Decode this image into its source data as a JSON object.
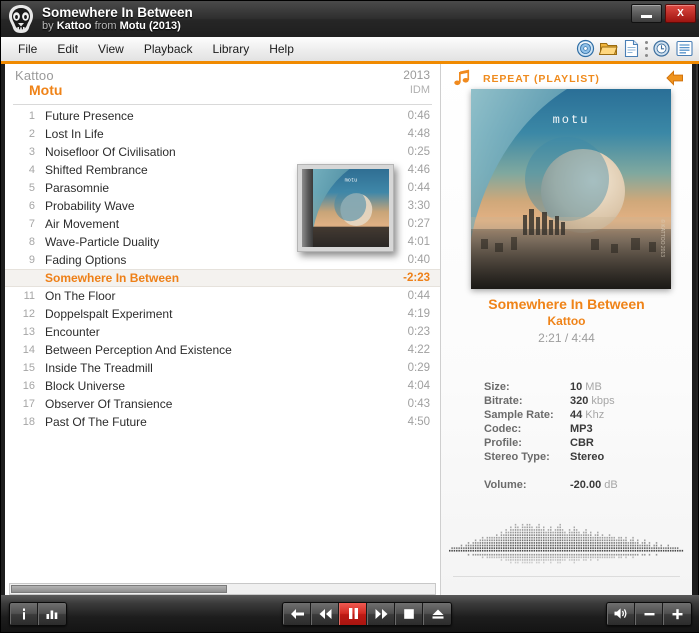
{
  "window": {
    "title": "Somewhere In Between",
    "subtitle_by": "by",
    "subtitle_artist": "Kattoo",
    "subtitle_from": "from",
    "subtitle_album": "Motu (2013)",
    "logo_icon": "foobar-skull-icon",
    "minimize_label": "minimize-button",
    "close_label": "X"
  },
  "menu": {
    "items": [
      {
        "label": "File"
      },
      {
        "label": "Edit"
      },
      {
        "label": "View"
      },
      {
        "label": "Playback"
      },
      {
        "label": "Library"
      },
      {
        "label": "Help"
      }
    ],
    "toolbar": [
      {
        "icon": "cd-disc-icon"
      },
      {
        "icon": "open-folder-icon"
      },
      {
        "icon": "new-file-icon"
      },
      {
        "icon": "separator-dots"
      },
      {
        "icon": "clock-history-icon"
      },
      {
        "icon": "playlist-list-icon"
      }
    ]
  },
  "playlist": {
    "group": {
      "artist": "Kattoo",
      "album": "Motu",
      "year": "2013",
      "genre": "IDM"
    },
    "tracks": [
      {
        "num": "1",
        "title": "Future Presence",
        "dur": "0:46",
        "playing": false
      },
      {
        "num": "2",
        "title": "Lost In Life",
        "dur": "4:48",
        "playing": false
      },
      {
        "num": "3",
        "title": "Noisefloor Of Civilisation",
        "dur": "0:25",
        "playing": false
      },
      {
        "num": "4",
        "title": "Shifted Rembrance",
        "dur": "4:46",
        "playing": false
      },
      {
        "num": "5",
        "title": "Parasomnie",
        "dur": "0:44",
        "playing": false
      },
      {
        "num": "6",
        "title": "Probability Wave",
        "dur": "3:30",
        "playing": false
      },
      {
        "num": "7",
        "title": "Air Movement",
        "dur": "0:27",
        "playing": false
      },
      {
        "num": "8",
        "title": "Wave-Particle Duality",
        "dur": "4:01",
        "playing": false
      },
      {
        "num": "9",
        "title": "Fading Options",
        "dur": "0:40",
        "playing": false
      },
      {
        "num": "",
        "title": "Somewhere In Between",
        "dur": "-2:23",
        "playing": true
      },
      {
        "num": "11",
        "title": "On The Floor",
        "dur": "0:44",
        "playing": false
      },
      {
        "num": "12",
        "title": "Doppelspalt Experiment",
        "dur": "4:19",
        "playing": false
      },
      {
        "num": "13",
        "title": "Encounter",
        "dur": "0:23",
        "playing": false
      },
      {
        "num": "14",
        "title": "Between Perception And Existence",
        "dur": "4:22",
        "playing": false
      },
      {
        "num": "15",
        "title": "Inside The Treadmill",
        "dur": "0:29",
        "playing": false
      },
      {
        "num": "16",
        "title": "Block Universe",
        "dur": "4:04",
        "playing": false
      },
      {
        "num": "17",
        "title": "Observer Of Transience",
        "dur": "0:43",
        "playing": false
      },
      {
        "num": "18",
        "title": "Past Of The Future",
        "dur": "4:50",
        "playing": false
      }
    ]
  },
  "side": {
    "note_icon": "music-note-icon",
    "repeat_mode": "REPEAT (PLAYLIST)",
    "back_icon": "back-arrow-icon",
    "album_art": {
      "logo_text": "motu",
      "credit_text": "© KATTOO  2013"
    },
    "now_playing": {
      "title": "Somewhere In Between",
      "artist": "Kattoo",
      "time": "2:21 / 4:44"
    },
    "metadata": [
      {
        "key": "Size:",
        "value": "10",
        "unit": " MB"
      },
      {
        "key": "Bitrate:",
        "value": "320",
        "unit": " kbps"
      },
      {
        "key": "Sample Rate:",
        "value": "44",
        "unit": " Khz"
      },
      {
        "key": "Codec:",
        "value": "MP3",
        "unit": ""
      },
      {
        "key": "Profile:",
        "value": "CBR",
        "unit": ""
      },
      {
        "key": "Stereo Type:",
        "value": "Stereo",
        "unit": ""
      }
    ],
    "volume_row": {
      "key": "Volume:",
      "value": "-20.00",
      "unit": " dB"
    },
    "visualizer": {
      "type": "spectrum-analyzer",
      "bars": [
        1,
        2,
        2,
        3,
        3,
        4,
        3,
        4,
        5,
        4,
        5,
        6,
        5,
        6,
        7,
        6,
        7,
        8,
        7,
        8,
        9,
        8,
        10,
        9,
        11,
        10,
        12,
        11,
        13,
        12,
        11,
        13,
        12,
        14,
        13,
        12,
        11,
        12,
        13,
        11,
        12,
        10,
        11,
        12,
        10,
        11,
        12,
        13,
        11,
        10,
        9,
        11,
        10,
        12,
        11,
        10,
        9,
        10,
        11,
        9,
        10,
        8,
        9,
        10,
        8,
        9,
        7,
        8,
        9,
        7,
        8,
        6,
        7,
        8,
        6,
        7,
        5,
        6,
        7,
        5,
        6,
        4,
        5,
        6,
        4,
        5,
        3,
        4,
        5,
        3,
        4,
        2,
        3,
        4,
        2,
        3,
        2,
        2,
        1,
        1
      ]
    }
  },
  "playlist_scrollbar": {
    "name": "horizontal-scrollbar"
  },
  "transport": {
    "left_buttons": [
      {
        "icon": "info-icon",
        "glyph": "i"
      },
      {
        "icon": "equalizer-icon",
        "glyph": "bars"
      }
    ],
    "center_buttons": [
      {
        "icon": "previous-icon"
      },
      {
        "icon": "rewind-icon"
      },
      {
        "icon": "pause-icon",
        "active": true
      },
      {
        "icon": "fast-forward-icon"
      },
      {
        "icon": "stop-icon"
      },
      {
        "icon": "eject-icon"
      }
    ],
    "right_buttons": [
      {
        "icon": "volume-speaker-icon"
      },
      {
        "icon": "volume-down-icon",
        "glyph": "−"
      },
      {
        "icon": "volume-up-icon",
        "glyph": "+"
      }
    ]
  },
  "colors": {
    "accent_orange": "#ef8318",
    "accent_bar": "#f08a00",
    "close_red": "#c4211b",
    "pause_red": "#d32a22"
  }
}
